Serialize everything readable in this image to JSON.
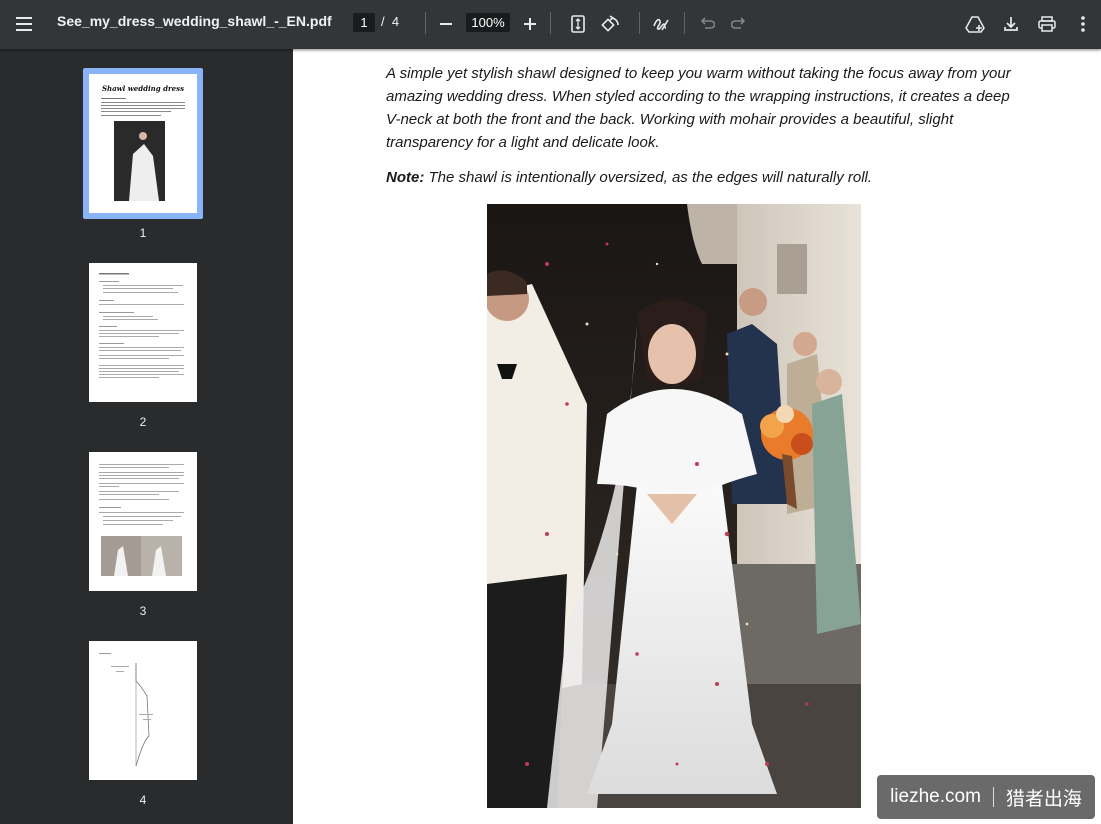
{
  "toolbar": {
    "title": "See_my_dress_wedding_shawl_-_EN.pdf",
    "current_page": "1",
    "page_separator": "/",
    "total_pages": "4",
    "zoom": "100%",
    "icons": [
      "menu-icon",
      "zoom-out-icon",
      "zoom-in-icon",
      "fit-page-icon",
      "rotate-icon",
      "annotate-icon",
      "undo-icon",
      "redo-icon",
      "drive-icon",
      "download-icon",
      "print-icon",
      "more-icon"
    ]
  },
  "sidebar": {
    "thumbnails": [
      {
        "label": "1",
        "selected": true
      },
      {
        "label": "2",
        "selected": false
      },
      {
        "label": "3",
        "selected": false
      },
      {
        "label": "4",
        "selected": false
      }
    ]
  },
  "document": {
    "paragraph": "A simple yet stylish shawl designed to keep you warm without taking the focus away from your amazing wedding dress. When styled according to the wrapping instructions, it creates a deep V-neck at both the front and the back. Working with mohair provides a beautiful, slight transparency for a light and delicate look.",
    "note_label": "Note:",
    "note_text": " The shawl is intentionally oversized, as the edges will naturally roll."
  },
  "watermark": {
    "site": "liezhe.com",
    "name": "猎者出海"
  }
}
